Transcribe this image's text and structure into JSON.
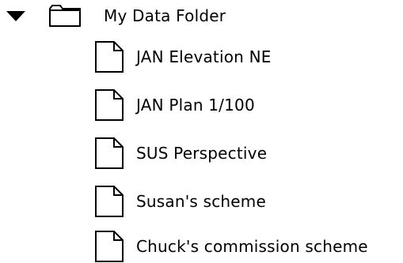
{
  "folder": {
    "name": "My Data Folder",
    "icon": "folder-icon",
    "disclosure_icon": "disclosure-triangle-down-icon",
    "expanded": true
  },
  "files": [
    {
      "label": "JAN Elevation NE",
      "icon": "document-icon"
    },
    {
      "label": "JAN Plan 1/100",
      "icon": "document-icon"
    },
    {
      "label": "SUS Perspective",
      "icon": "document-icon"
    },
    {
      "label": "Susan's scheme",
      "icon": "document-icon"
    },
    {
      "label": "Chuck's commission scheme",
      "icon": "document-icon"
    }
  ]
}
